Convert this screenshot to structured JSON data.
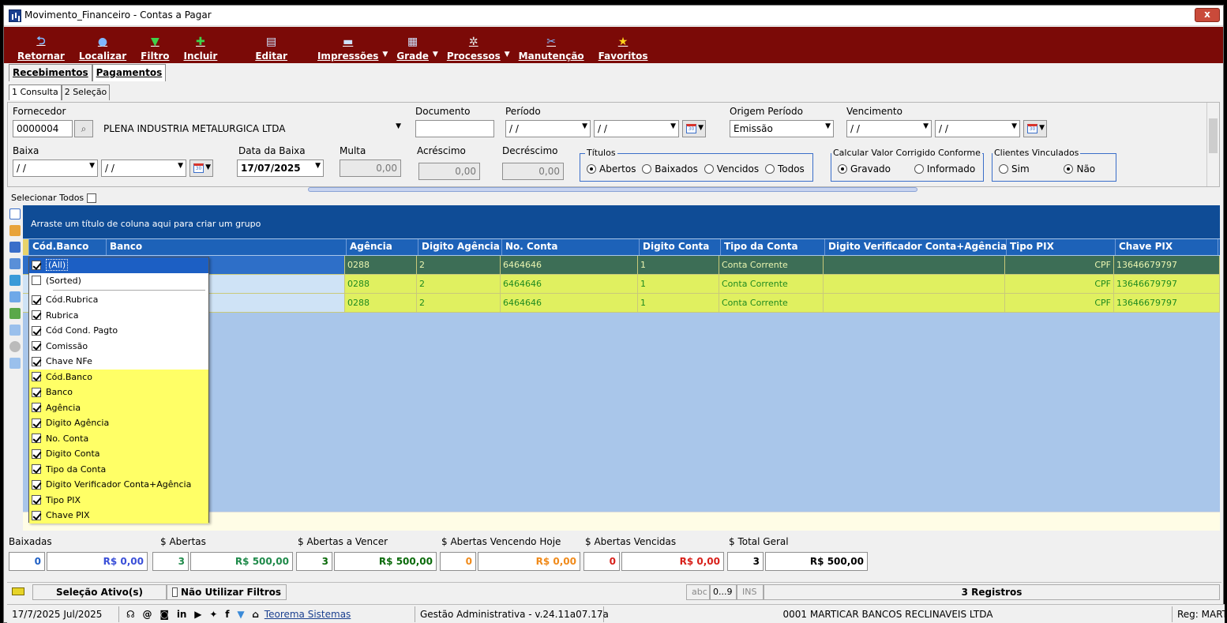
{
  "window": {
    "title": "Movimento_Financeiro - Contas a Pagar",
    "close_label": "x"
  },
  "toolbar": [
    {
      "label": "Retornar",
      "icon": "return-icon"
    },
    {
      "label": "Localizar",
      "icon": "search-icon"
    },
    {
      "label": "Filtro",
      "icon": "filter-icon"
    },
    {
      "label": "Incluir",
      "icon": "add-icon"
    },
    {
      "label": "Editar",
      "icon": "edit-icon"
    },
    {
      "label": "Impressões",
      "icon": "print-icon"
    },
    {
      "label": "Grade",
      "icon": "grid-icon"
    },
    {
      "label": "Processos",
      "icon": "gear-icon"
    },
    {
      "label": "Manutenção",
      "icon": "tools-icon"
    },
    {
      "label": "Favoritos",
      "icon": "star-icon"
    }
  ],
  "tabs": {
    "main": [
      "Recebimentos",
      "Pagamentos"
    ],
    "sub": [
      "1 Consulta",
      "2 Seleção"
    ]
  },
  "filters": {
    "fornecedor_label": "Fornecedor",
    "fornecedor_code": "0000004",
    "fornecedor_name": "PLENA INDUSTRIA METALURGICA LTDA",
    "documento_label": "Documento",
    "documento_value": "",
    "periodo_label": "Período",
    "periodo_from": "/ /",
    "periodo_to": "/ /",
    "origem_label": "Origem Período",
    "origem_value": "Emissão",
    "vencimento_label": "Vencimento",
    "vencimento_from": "/ /",
    "vencimento_to": "/ /",
    "baixa_label": "Baixa",
    "baixa_from": "/ /",
    "baixa_to": "/ /",
    "data_baixa_label": "Data da Baixa",
    "data_baixa_value": "17/07/2025",
    "multa_label": "Multa",
    "multa_value": "0,00",
    "acrescimo_label": "Acréscimo",
    "acrescimo_value": "0,00",
    "decrescimo_label": "Decréscimo",
    "decrescimo_value": "0,00",
    "titulos_label": "Títulos",
    "titulos_options": [
      "Abertos",
      "Baixados",
      "Vencidos",
      "Todos"
    ],
    "calcular_label": "Calcular Valor Corrigido Conforme",
    "calcular_options": [
      "Gravado",
      "Informado"
    ],
    "clientes_label": "Clientes Vinculados",
    "clientes_options": [
      "Sim",
      "Não"
    ],
    "selecionar_todos": "Selecionar Todos"
  },
  "grid": {
    "group_hint": "Arraste um título de coluna aqui para criar um grupo",
    "columns": [
      "Cód.Banco",
      "Banco",
      "Agência",
      "Digito Agência",
      "No. Conta",
      "Digito Conta",
      "Tipo da Conta",
      "Digito Verificador Conta+Agência",
      "Tipo PIX",
      "Chave PIX"
    ],
    "rows": [
      [
        "0288",
        "2",
        "6464646",
        "1",
        "Conta Corrente",
        "",
        "CPF",
        "13646679797"
      ],
      [
        "0288",
        "2",
        "6464646",
        "1",
        "Conta Corrente",
        "",
        "CPF",
        "13646679797"
      ],
      [
        "0288",
        "2",
        "6464646",
        "1",
        "Conta Corrente",
        "",
        "CPF",
        "13646679797"
      ]
    ]
  },
  "column_chooser": {
    "items": [
      "(All)",
      "(Sorted)",
      "Cód.Rubrica",
      "Rubrica",
      "Cód Cond. Pagto",
      "Comissão",
      "Chave NFe",
      "Cód.Banco",
      "Banco",
      "Agência",
      "Digito Agência",
      "No. Conta",
      "Digito Conta",
      "Tipo da Conta",
      "Digito Verificador Conta+Agência",
      "Tipo PIX",
      "Chave PIX"
    ]
  },
  "totals": {
    "baixadas_label": "Baixadas",
    "baixadas_count": "0",
    "baixadas_value": "R$ 0,00",
    "abertas_label": "$ Abertas",
    "abertas_count": "3",
    "abertas_value": "R$ 500,00",
    "a_vencer_label": "$ Abertas a Vencer",
    "a_vencer_count": "3",
    "a_vencer_value": "R$ 500,00",
    "hoje_label": "$ Abertas Vencendo Hoje",
    "hoje_count": "0",
    "hoje_value": "R$ 0,00",
    "vencidas_label": "$ Abertas Vencidas",
    "vencidas_count": "0",
    "vencidas_value": "R$ 0,00",
    "geral_label": "$ Total Geral",
    "geral_count": "3",
    "geral_value": "R$ 500,00"
  },
  "status1": {
    "selecao": "Seleção Ativo(s)",
    "nao_utilizar": "Não Utilizar Filtros",
    "abc": "abc",
    "range": "0...9",
    "ins": "INS",
    "registros": "3 Registros"
  },
  "status2": {
    "date": "17/7/2025 Jul/2025",
    "company_link": "Teorema Sistemas",
    "version": "Gestão Administrativa - v.24.11a07.17a",
    "empresa": "0001 MARTICAR BANCOS RECLINAVEIS LTDA",
    "reg": "Reg: MARTI"
  },
  "colors": {
    "toolbar": "#7b0a07",
    "grid_header": "#1d62b8",
    "group_area": "#0f4c96",
    "row_highlight": "#e0f060",
    "selected_row": "#3d6e56"
  }
}
